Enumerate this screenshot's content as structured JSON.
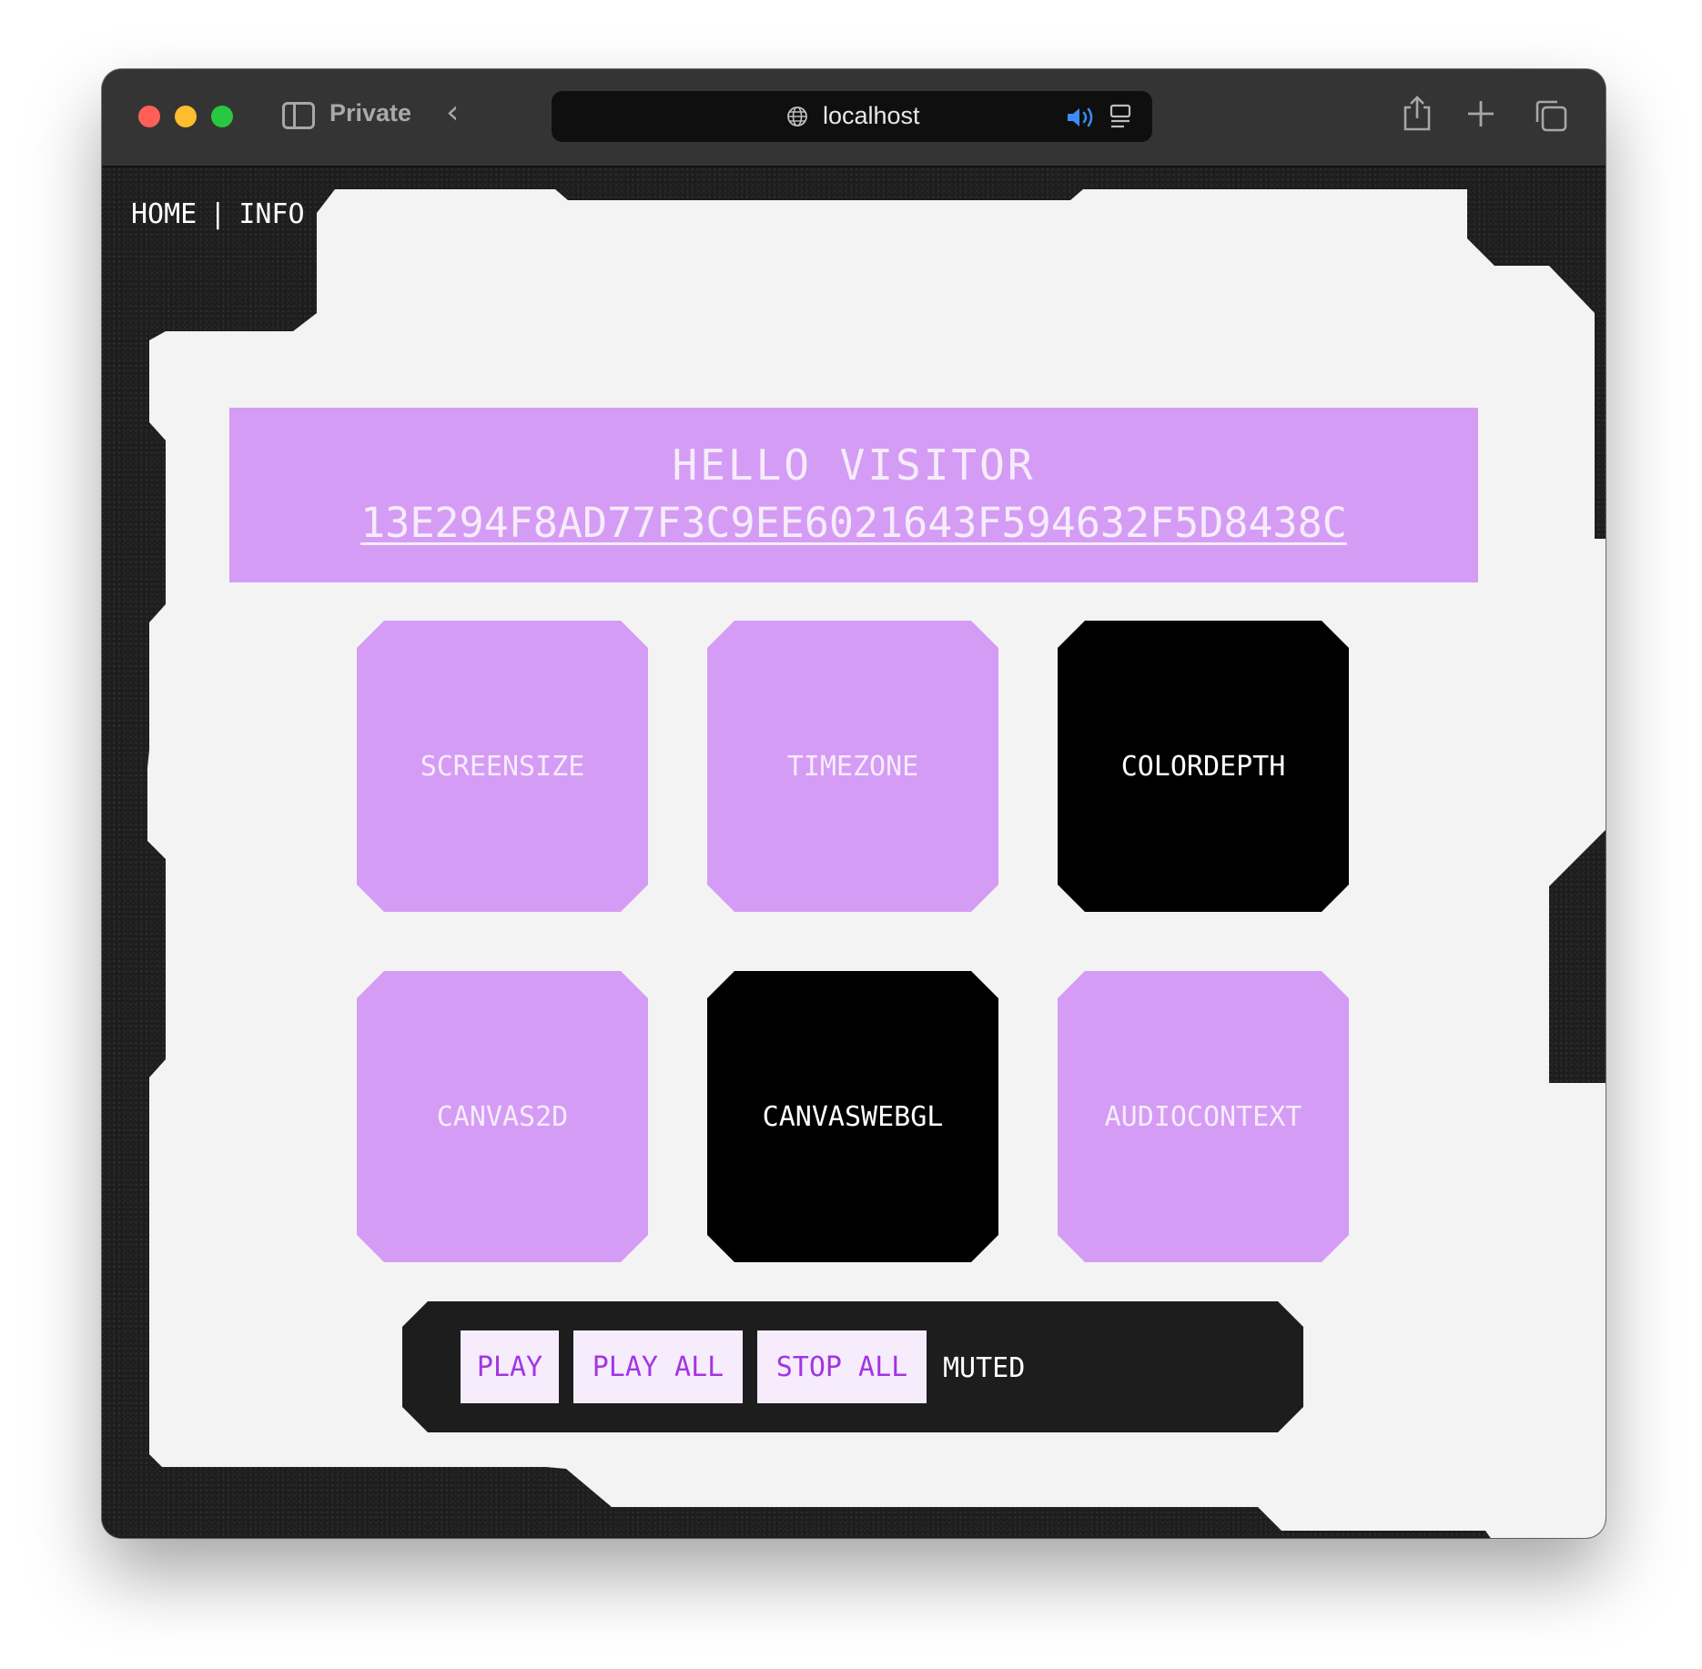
{
  "browser": {
    "private_label": "Private",
    "url": "localhost"
  },
  "nav": {
    "home": "HOME",
    "separator": "|",
    "info": "INFO"
  },
  "hero": {
    "title": "HELLO VISITOR",
    "hash": "13E294F8AD77F3C9EE6021643F594632F5D8438C"
  },
  "tiles": [
    {
      "label": "SCREENSIZE",
      "state": "inactive"
    },
    {
      "label": "TIMEZONE",
      "state": "inactive"
    },
    {
      "label": "COLORDEPTH",
      "state": "active"
    },
    {
      "label": "CANVAS2D",
      "state": "inactive"
    },
    {
      "label": "CANVASWEBGL",
      "state": "active"
    },
    {
      "label": "AUDIOCONTEXT",
      "state": "inactive"
    }
  ],
  "controls": {
    "play": "PLAY",
    "play_all": "PLAY ALL",
    "stop_all": "STOP ALL",
    "status": "MUTED"
  },
  "colors": {
    "accent_purple": "#d59cf5",
    "button_text": "#a235e3",
    "panel_light": "#f3f3f3",
    "frame_dark": "#1d1d1d"
  },
  "icons": {
    "toolbar": [
      "sidebar-icon",
      "back-arrow-icon",
      "globe-icon",
      "speaker-icon",
      "reader-icon",
      "share-icon",
      "plus-icon",
      "tabs-icon"
    ]
  }
}
